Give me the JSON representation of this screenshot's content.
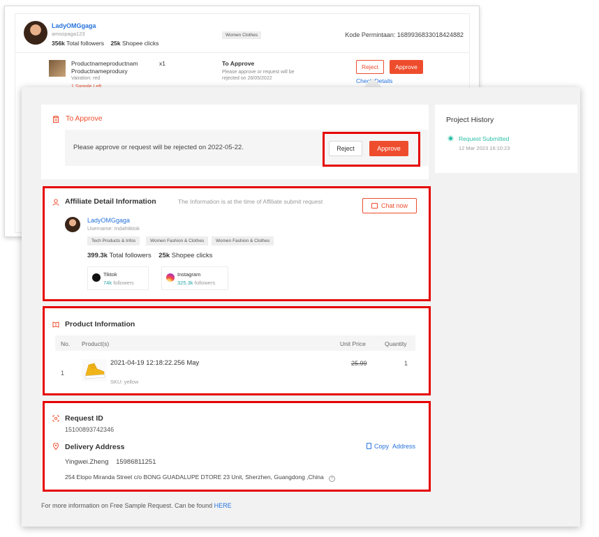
{
  "background_card": {
    "affiliate_name": "LadyOMGgaga",
    "username": "amsopaga123",
    "followers": "356k",
    "followers_label": "Total followers",
    "clicks": "25k",
    "clicks_label": "Shopee clicks",
    "tag": "Women Clothes",
    "request_code_label": "Kode Permintaan:",
    "request_code": "1689936833018424882",
    "product_name": "Productnameproductnamproductnameproductnameproduxy",
    "product_name_display": "Productnameproductnam Productnameproduxy",
    "quantity": "x1",
    "variation": "Vairation: red",
    "sample_left": "1 Sample Left",
    "status_title": "To Approve",
    "status_desc": "Please approve or request will be rejected on 26/05/2022",
    "reject_label": "Reject",
    "approve_label": "Approve",
    "check_details": "Check Details"
  },
  "to_approve": {
    "title": "To Approve",
    "message": "Please approve or request will be rejected on 2022-05-22.",
    "reject_label": "Reject",
    "approve_label": "Approve"
  },
  "project_history": {
    "title": "Project History",
    "items": [
      {
        "label": "Request Submitted",
        "time": "12 Mar 2023 16:10:23"
      }
    ]
  },
  "affiliate": {
    "title": "Affiliate Detail Information",
    "subtitle": "The Information is at the time of Affiliate submit request",
    "chat_label": "Chat now",
    "name": "LadyOMGgaga",
    "username": "Username: Indahtiktok",
    "tags": [
      "Tech Products & Infos",
      "Women Fashion & Clothes",
      "Women Fashion & Clothes"
    ],
    "followers": "399.3k",
    "followers_label": "Total followers",
    "clicks": "25k",
    "clicks_label": "Shopee clicks",
    "socials": [
      {
        "name": "Tiktok",
        "followers": "74k",
        "followers_label": "followers",
        "icon": "tiktok-icon"
      },
      {
        "name": "Instagram",
        "followers": "325.3k",
        "followers_label": "followers",
        "icon": "instagram-icon"
      }
    ]
  },
  "product": {
    "title": "Product Information",
    "headers": {
      "no": "No.",
      "product": "Product(s)",
      "unit_price": "Unit Price",
      "quantity": "Quantity"
    },
    "rows": [
      {
        "no": "1",
        "name": "2021-04-19 12:18:22.256 May",
        "sku": "SKU: yellow",
        "unit_price": "25.99",
        "quantity": "1"
      }
    ]
  },
  "request": {
    "title": "Request ID",
    "id": "15100893742346",
    "delivery_title": "Delivery Address",
    "copy_label": "Copy",
    "copy_label2": "Address",
    "recipient": "Yingwei.Zheng",
    "phone": "15986811251",
    "address": "254 Elopo Miranda Street c/o BONG GUADALUPE DTORE 23 Unit, Sherzhen, Guangdong ,China"
  },
  "footer": {
    "text": "For more information on Free Sample Request. Can be found",
    "link": "HERE"
  },
  "colors": {
    "accent": "#ee4d2d",
    "link": "#2673dd",
    "highlight": "#e50000",
    "success": "#2bbfa6"
  }
}
